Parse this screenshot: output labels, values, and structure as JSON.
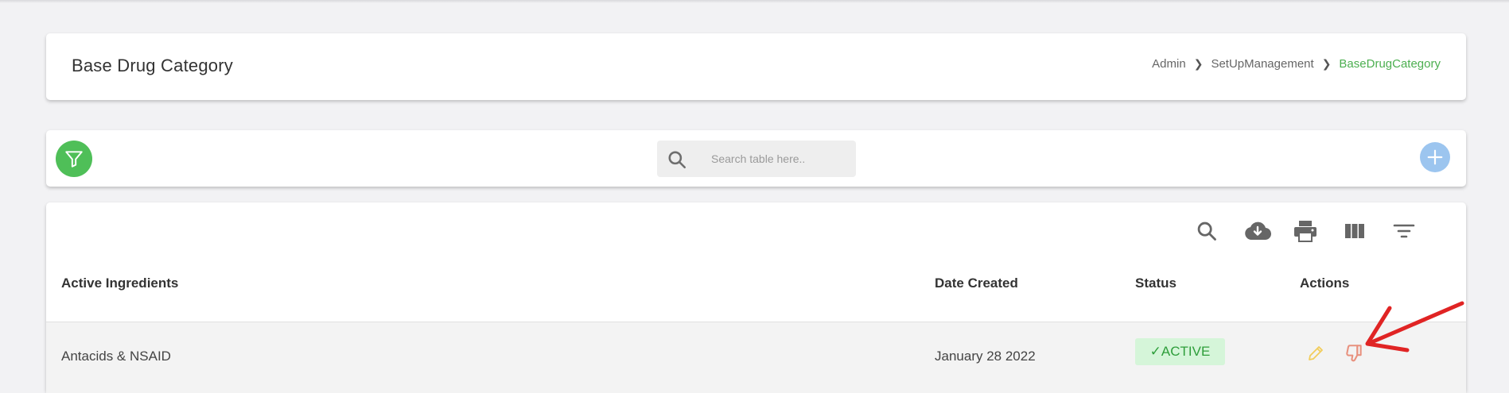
{
  "page": {
    "title": "Base Drug Category",
    "breadcrumb": [
      "Admin",
      "SetUpManagement",
      "BaseDrugCategory"
    ]
  },
  "toolbar": {
    "search_placeholder": "Search table here..",
    "filter_icon": "filter-icon",
    "add_icon": "plus-icon"
  },
  "table": {
    "tools": [
      "search-icon",
      "cloud-download-icon",
      "print-icon",
      "view-columns-icon",
      "filter-list-icon"
    ],
    "columns": [
      "Active Ingredients",
      "Date Created",
      "Status",
      "Actions"
    ],
    "rows": [
      {
        "ingredient": "Antacids & NSAID",
        "date_created": "January 28 2022",
        "status": "✓ACTIVE",
        "actions": [
          "pencil-icon",
          "thumbs-down-icon"
        ]
      }
    ]
  },
  "colors": {
    "accent": "#4caf50",
    "filter_button": "#4fbf58",
    "add_button": "#9cc5ef",
    "status_bg": "#d5f5d9",
    "edit_icon": "#f5d76e",
    "deactivate_icon": "#e8917e",
    "annotation_arrow": "#e02424"
  }
}
